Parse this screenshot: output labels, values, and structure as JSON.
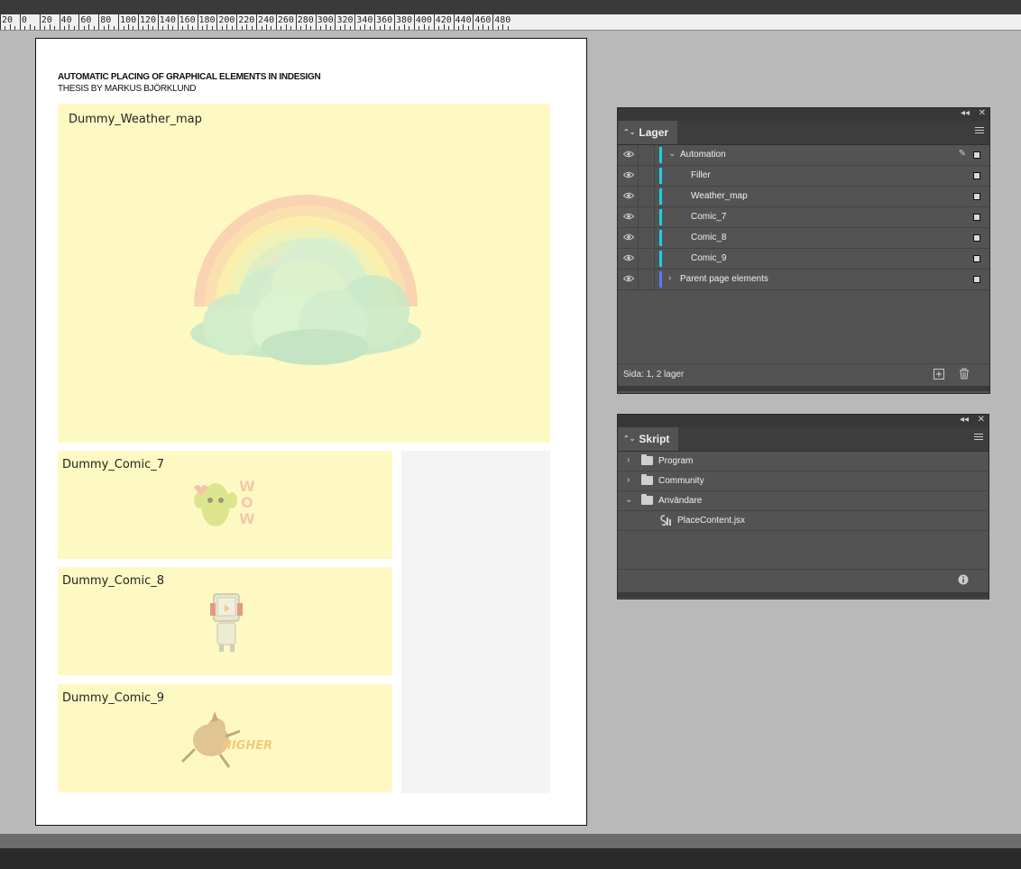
{
  "ruler": {
    "labels": [
      "20",
      "0",
      "20",
      "40",
      "60",
      "80",
      "100",
      "120",
      "140",
      "160",
      "180",
      "200",
      "220",
      "240",
      "260",
      "280",
      "300",
      "320",
      "340",
      "360",
      "380",
      "400",
      "420",
      "440",
      "460",
      "480"
    ]
  },
  "document": {
    "title": "AUTOMATIC PLACING OF GRAPHICAL ELEMENTS IN INDESIGN",
    "subtitle": "THESIS BY MARKUS BJÖRKLUND",
    "frames": [
      {
        "label": "Dummy_Weather_map"
      },
      {
        "label": "Dummy_Comic_7"
      },
      {
        "label": "Dummy_Comic_8"
      },
      {
        "label": "Dummy_Comic_9"
      }
    ],
    "comic9_text": "HIGHER"
  },
  "layers_panel": {
    "tab": "Lager",
    "layers": [
      {
        "name": "Automation",
        "color": "#17d4e3"
      },
      {
        "name": "Filler",
        "color": "#17d4e3"
      },
      {
        "name": "Weather_map",
        "color": "#17d4e3"
      },
      {
        "name": "Comic_7",
        "color": "#17d4e3"
      },
      {
        "name": "Comic_8",
        "color": "#17d4e3"
      },
      {
        "name": "Comic_9",
        "color": "#17d4e3"
      },
      {
        "name": "Parent page elements",
        "color": "#5a78ff"
      }
    ],
    "footer": "Sida: 1, 2 lager"
  },
  "scripts_panel": {
    "tab": "Skript",
    "items": [
      {
        "name": "Program"
      },
      {
        "name": "Community"
      },
      {
        "name": "Användare"
      },
      {
        "name": "PlaceContent.jsx"
      }
    ]
  }
}
